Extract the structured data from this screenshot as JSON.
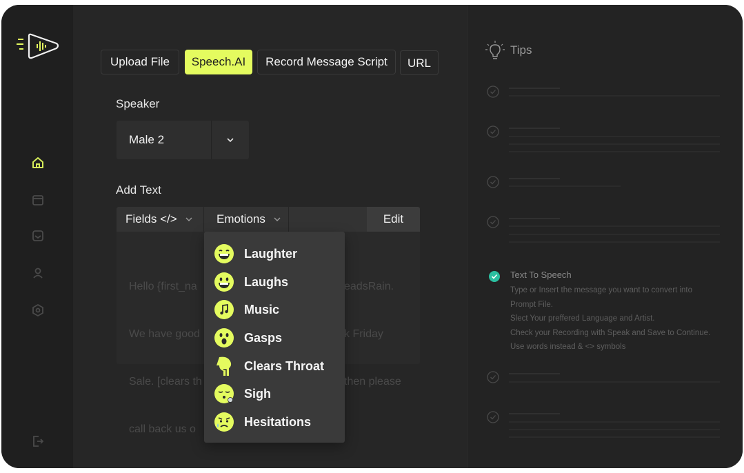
{
  "tabs": [
    {
      "label": "Upload File",
      "active": false
    },
    {
      "label": "Speech.AI",
      "active": true
    },
    {
      "label": "Record Message Script",
      "active": false
    },
    {
      "label": "URL",
      "active": false
    }
  ],
  "speaker": {
    "label": "Speaker",
    "value": "Male 2"
  },
  "add_text": {
    "label": "Add Text",
    "fields_label": "Fields </>",
    "emotions_label": "Emotions",
    "edit_label": "Edit",
    "editor_lines": [
      "Hello {first_na",
      "We have good",
      "Sale. [clears th",
      "call back us o"
    ],
    "editor_right_lines": [
      "eadsRain.",
      "k Friday",
      "then please",
      ""
    ]
  },
  "emotions": [
    {
      "label": "Laughter",
      "icon": "laughter-emoji-icon"
    },
    {
      "label": "Laughs",
      "icon": "laughs-emoji-icon"
    },
    {
      "label": "Music",
      "icon": "music-emoji-icon"
    },
    {
      "label": "Gasps",
      "icon": "gasps-emoji-icon"
    },
    {
      "label": "Clears Throat",
      "icon": "clears-throat-icon"
    },
    {
      "label": "Sigh",
      "icon": "sigh-emoji-icon"
    },
    {
      "label": "Hesitations",
      "icon": "hesitations-emoji-icon"
    }
  ],
  "tips": {
    "title": "Tips",
    "active_tip": {
      "title": "Text To Speech",
      "lines": [
        "Type or Insert the message you want to convert into",
        "Prompt File.",
        "Slect Your preffered Language and Artist.",
        "Check your Recording with Speak and Save to Continue.",
        "Use words instead & <> symbols"
      ]
    }
  },
  "colors": {
    "accent": "#e4fb5f",
    "check_active": "#2bbfa0",
    "bg": "#232323"
  }
}
